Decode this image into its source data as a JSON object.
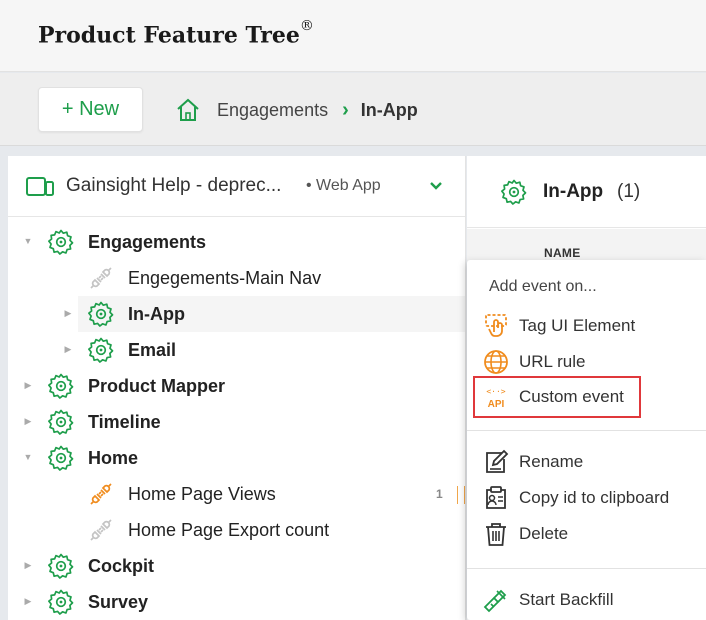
{
  "app": {
    "title": "Product Feature Tree",
    "title_mark": "®"
  },
  "toolbar": {
    "new_label": "+ New",
    "breadcrumb": [
      {
        "label": "Engagements"
      },
      {
        "label": "In-App"
      }
    ]
  },
  "left_panel": {
    "app_name": "Gainsight Help - deprec...",
    "app_type": "• Web App",
    "tree": [
      {
        "label": "Engagements",
        "bold": true,
        "level": 0,
        "toggle": "▼",
        "icon": "gear-icon"
      },
      {
        "label": "Engegements-Main Nav",
        "bold": false,
        "level": 1,
        "toggle": "",
        "icon": "plug-icon"
      },
      {
        "label": "In-App",
        "bold": true,
        "level": 1,
        "toggle": "▶",
        "icon": "gear-icon",
        "selected": true
      },
      {
        "label": "Email",
        "bold": true,
        "level": 1,
        "toggle": "▶",
        "icon": "gear-icon"
      },
      {
        "label": "Product Mapper",
        "bold": true,
        "level": 0,
        "toggle": "▶",
        "icon": "gear-icon"
      },
      {
        "label": "Timeline",
        "bold": true,
        "level": 0,
        "toggle": "▶",
        "icon": "gear-icon"
      },
      {
        "label": "Home",
        "bold": true,
        "level": 0,
        "toggle": "▼",
        "icon": "gear-icon"
      },
      {
        "label": "Home Page Views",
        "bold": false,
        "level": 1,
        "toggle": "",
        "icon": "plug-active-icon",
        "count": "1"
      },
      {
        "label": "Home Page Export count",
        "bold": false,
        "level": 1,
        "toggle": "",
        "icon": "plug-icon"
      },
      {
        "label": "Cockpit",
        "bold": true,
        "level": 0,
        "toggle": "▶",
        "icon": "gear-icon"
      },
      {
        "label": "Survey",
        "bold": true,
        "level": 0,
        "toggle": "▶",
        "icon": "gear-icon"
      }
    ]
  },
  "right_panel": {
    "title": "In-App",
    "count": "(1)",
    "column_header": "NAME"
  },
  "context_menu": {
    "title": "Add event on...",
    "items": [
      {
        "label": "Tag UI Element",
        "icon": "tag-ui-element-icon"
      },
      {
        "label": "URL rule",
        "icon": "globe-icon"
      },
      {
        "label": "Custom event",
        "icon": "api-icon",
        "highlighted": true
      }
    ],
    "actions": [
      {
        "label": "Rename",
        "icon": "edit-icon"
      },
      {
        "label": "Copy id to clipboard",
        "icon": "copy-id-icon"
      },
      {
        "label": "Delete",
        "icon": "trash-icon"
      }
    ],
    "footer": [
      {
        "label": "Start Backfill",
        "icon": "backfill-icon"
      }
    ]
  },
  "colors": {
    "brand_green": "#1e9e4b",
    "accent_orange": "#f08c1e",
    "highlight_red": "#e0383b"
  }
}
